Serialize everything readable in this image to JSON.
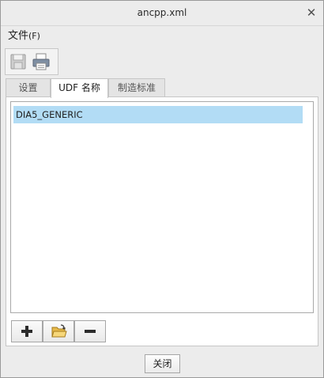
{
  "window": {
    "title": "ancpp.xml",
    "close_icon": "close-icon"
  },
  "menubar": {
    "file_label": "文件",
    "file_mnemonic": "(F)"
  },
  "toolbar": {
    "save_icon": "save-icon",
    "print_icon": "print-icon"
  },
  "tabs": [
    {
      "label": "设置",
      "selected": false
    },
    {
      "label": "UDF 名称",
      "selected": true
    },
    {
      "label": "制造标准",
      "selected": false
    }
  ],
  "udf_list": {
    "items": [
      {
        "label": "DIA5_GENERIC",
        "selected": true
      }
    ]
  },
  "list_buttons": {
    "add_icon": "plus-icon",
    "open_icon": "open-folder-icon",
    "remove_icon": "minus-icon"
  },
  "footer": {
    "close_label": "关闭"
  },
  "colors": {
    "selection": "#b2dcf5",
    "window_bg": "#ececec",
    "panel_bg": "#ffffff"
  }
}
